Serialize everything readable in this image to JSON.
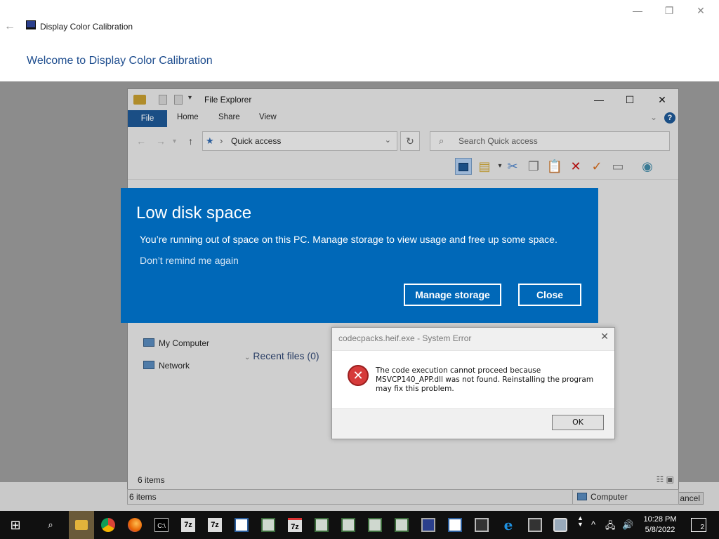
{
  "calibration_window": {
    "title": "Display Color Calibration",
    "heading": "Welcome to Display Color Calibration",
    "cancel_fragment": "ancel"
  },
  "explorer": {
    "title": "File Explorer",
    "tabs": [
      "File",
      "Home",
      "Share",
      "View"
    ],
    "address_path": "Quick access",
    "search_placeholder": "Search Quick access",
    "sidebar": [
      "My Computer",
      "Network"
    ],
    "recent_files": "Recent files (0)",
    "status_items": "6 items",
    "status_computer": "Computer"
  },
  "toast": {
    "title": "Low disk space",
    "message": "You’re running out of space on this PC. Manage storage to view usage and free up some space.",
    "link": "Don’t remind me again",
    "manage_button": "Manage storage",
    "close_button": "Close",
    "background_color": "#0068b8"
  },
  "error_dialog": {
    "title": "codecpacks.heif.exe - System Error",
    "message": "The code execution cannot proceed because MSVCP140_APP.dll was not found. Reinstalling the program may fix this problem.",
    "ok_button": "OK"
  },
  "taskbar": {
    "time": "10:28 PM",
    "date": "5/8/2022",
    "notification_count": "2",
    "apps": [
      "start",
      "search",
      "file-explorer",
      "chrome",
      "firefox",
      "cmd",
      "7zip",
      "7zip",
      "app",
      "app",
      "7zip",
      "app",
      "app",
      "app",
      "app",
      "display",
      "app",
      "ie",
      "app",
      "app"
    ]
  }
}
